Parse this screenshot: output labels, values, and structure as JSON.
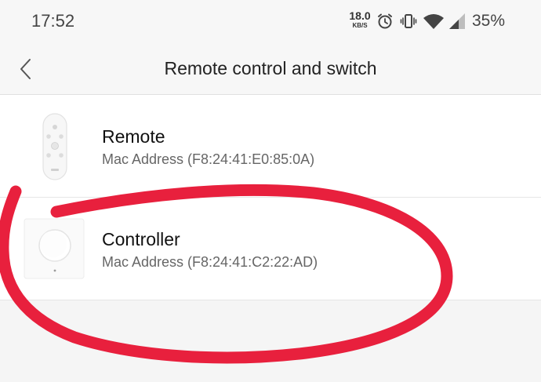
{
  "status_bar": {
    "time": "17:52",
    "net_speed_value": "18.0",
    "net_speed_unit": "KB/S",
    "battery": "35%",
    "icons": [
      "alarm-icon",
      "vibrate-icon",
      "wifi-icon",
      "cellular-signal-icon"
    ]
  },
  "header": {
    "back_icon": "chevron-left-icon",
    "title": "Remote control and switch"
  },
  "devices": [
    {
      "name": "Remote",
      "mac": "Mac Address (F8:24:41:E0:85:0A)",
      "icon": "remote-device-image"
    },
    {
      "name": "Controller",
      "mac": "Mac Address (F8:24:41:C2:22:AD)",
      "icon": "controller-device-image"
    }
  ],
  "colors": {
    "background": "#f5f5f5",
    "card": "#ffffff",
    "annotation": "#e8203d"
  }
}
